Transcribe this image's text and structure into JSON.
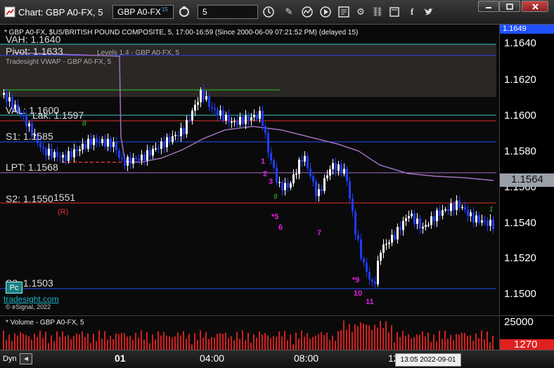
{
  "toolbar": {
    "title": "Chart: GBP A0-FX, 5",
    "symbol": "GBP A0-FX",
    "symbol_superscript": "15",
    "interval": "5"
  },
  "chart": {
    "header": "* GBP A0-FX, $US/BRITISH POUND COMPOSITE, 5, 17:00-16:59 (Since 2000-06-09 07:21:52 PM) (delayed 15)",
    "sub1": "Levels 1.4 - GBP A0-FX, 5",
    "sub2": "Tradesight VWAP - GBP A0-FX, 5",
    "levels": {
      "vah": "VAH: 1.1640",
      "pivot": "Pivot: 1.1633",
      "val": "VAL: 1.1600",
      "lak": "Lak: 1.1597",
      "s1": "S1: 1.1585",
      "lpt": "LPT: 1.1568",
      "s2": "S2: 1.1550",
      "s2b": "1551",
      "r": "(R)",
      "s3": "S3: 1.1503"
    },
    "footer": {
      "pc": "Pc",
      "site": "tradesight.com",
      "copyright": "© eSignal, 2022"
    },
    "counts": [
      "1",
      "2",
      "3",
      "*5",
      "6",
      "7",
      "*9",
      "10",
      "11"
    ],
    "greens": [
      "8",
      "9",
      "1"
    ]
  },
  "price_axis": {
    "top_label": "1.1649",
    "ticks": [
      "1.1640",
      "1.1620",
      "1.1600",
      "1.1580",
      "1.1560",
      "1.1540",
      "1.1520",
      "1.1500"
    ],
    "current": "1.1564"
  },
  "volume": {
    "title": "* Volume - GBP A0-FX, 5",
    "tick": "25000",
    "current": "1270"
  },
  "time_axis": {
    "dyn": "Dyn",
    "ticks": [
      "01",
      "04:00",
      "08:00",
      "12"
    ],
    "cursor": "13:05 2022-09-01"
  },
  "colors": {
    "bar_up": "#ffffff",
    "bar_down": "#1e3cff",
    "vwap": "#a070c0",
    "resistance": "#e03030",
    "support": "#2050ff",
    "count": "#e020e0",
    "volume": "#d02020",
    "current_price_bg": "#9aa0a8",
    "volume_current_bg": "#e02020"
  },
  "icons": [
    "chart-icon",
    "refresh-icon",
    "clock-icon",
    "pencil-icon",
    "draw-icon",
    "play-icon",
    "news-icon",
    "settings-icon",
    "link-icon",
    "bookmark-icon",
    "facebook-icon",
    "twitter-icon"
  ]
}
